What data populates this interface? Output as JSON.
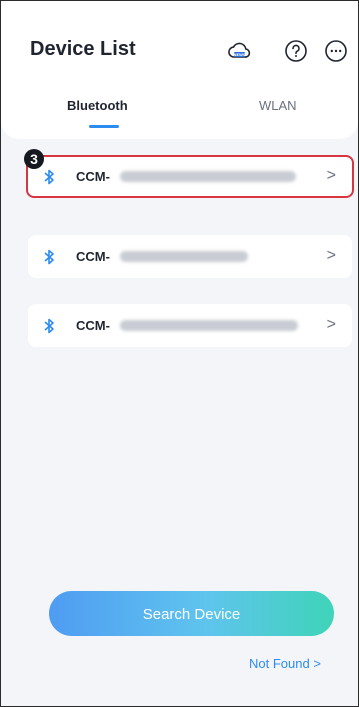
{
  "header": {
    "title": "Device List",
    "icons": [
      "cloud-news-icon",
      "help-icon",
      "more-icon"
    ],
    "cloud_icon_text": "NEWS"
  },
  "tabs": [
    {
      "label": "Bluetooth",
      "active": true
    },
    {
      "label": "WLAN",
      "active": false
    }
  ],
  "step_badge": "3",
  "devices": [
    {
      "name": "CCM-",
      "highlighted": true
    },
    {
      "name": "CCM-",
      "highlighted": false
    },
    {
      "name": "CCM-",
      "highlighted": false
    }
  ],
  "chevron": ">",
  "search_button": "Search Device",
  "not_found_link": "Not Found >",
  "colors": {
    "accent": "#2d8cf0",
    "highlight_border": "#d7353f",
    "gradient_start": "#4f9cf2",
    "gradient_end": "#3fd4b8"
  }
}
